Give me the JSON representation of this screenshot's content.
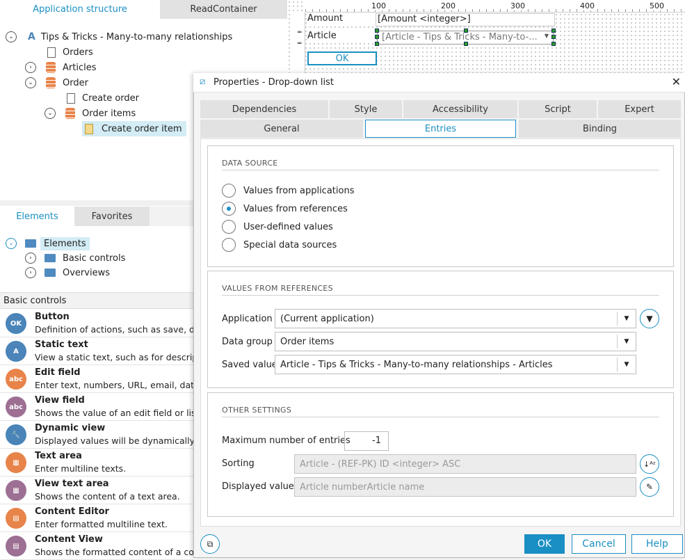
{
  "left_tabs": {
    "app_structure": "Application structure",
    "read_container": "ReadContainer"
  },
  "tree": {
    "root": "Tips & Tricks - Many-to-many relationships",
    "orders": "Orders",
    "articles": "Articles",
    "order": "Order",
    "create_order": "Create order",
    "order_items": "Order items",
    "create_order_item": "Create order item"
  },
  "element_tabs": {
    "elements": "Elements",
    "favorites": "Favorites"
  },
  "element_tree": {
    "root": "Elements",
    "basic_controls": "Basic controls",
    "overviews": "Overviews"
  },
  "controls": {
    "header": "Basic controls",
    "items": [
      {
        "name": "Button",
        "desc": "Definition of actions, such as save, dele",
        "icon": "OK",
        "color": "#4a84b8"
      },
      {
        "name": "Static text",
        "desc": "View a static text, such as for descriptio",
        "icon": "A",
        "color": "#4a84b8"
      },
      {
        "name": "Edit field",
        "desc": "Enter text, numbers, URL, email, date, ",
        "icon": "abc",
        "color": "#e8844a"
      },
      {
        "name": "View field",
        "desc": "Shows the value of an edit field or listb",
        "icon": "abc",
        "color": "#9c6f93"
      },
      {
        "name": "Dynamic view",
        "desc": "Displayed values will be dynamically de",
        "icon": "🔧",
        "color": "#4a84b8"
      },
      {
        "name": "Text area",
        "desc": "Enter multiline texts.",
        "icon": "▦",
        "color": "#e8844a"
      },
      {
        "name": "View text area",
        "desc": "Shows the content of a text area.",
        "icon": "▦",
        "color": "#9c6f93"
      },
      {
        "name": "Content Editor",
        "desc": "Enter formatted multiline text.",
        "icon": "▤",
        "color": "#e8844a"
      },
      {
        "name": "Content View",
        "desc": "Shows the formatted content of a cont",
        "icon": "▤",
        "color": "#9c6f93"
      }
    ]
  },
  "designer": {
    "ruler": [
      "100",
      "200",
      "300",
      "400",
      "500"
    ],
    "amount_label": "Amount",
    "amount_value": "[Amount <integer>]",
    "article_label": "Article",
    "article_value": "[Article - Tips & Tricks - Many-to-...",
    "ok": "OK"
  },
  "dialog": {
    "title": "Properties - Drop-down list",
    "tabs_row1": [
      "Dependencies",
      "Style",
      "Accessibility",
      "Script",
      "Expert"
    ],
    "tabs_row2": [
      "General",
      "Entries",
      "Binding"
    ],
    "active_tab": "Entries",
    "data_source": {
      "title": "DATA SOURCE",
      "options": [
        "Values from applications",
        "Values from references",
        "User-defined values",
        "Special data sources"
      ],
      "selected": "Values from references"
    },
    "references": {
      "title": "VALUES FROM REFERENCES",
      "application_label": "Application",
      "application_value": "(Current application)",
      "data_group_label": "Data group",
      "data_group_value": "Order items",
      "saved_value_label": "Saved value",
      "saved_value_value": "Article - Tips & Tricks - Many-to-many relationships - Articles"
    },
    "other": {
      "title": "OTHER SETTINGS",
      "max_entries_label": "Maximum number of entries",
      "max_entries_value": "-1",
      "sorting_label": "Sorting",
      "sorting_value": "Article - (REF-PK) ID <integer> ASC",
      "displayed_label": "Displayed values",
      "displayed_value": "Article numberArticle name"
    },
    "buttons": {
      "ok": "OK",
      "cancel": "Cancel",
      "help": "Help"
    }
  },
  "colors": {
    "accent": "#1a8fc3",
    "selection": "#d3ecf5"
  }
}
